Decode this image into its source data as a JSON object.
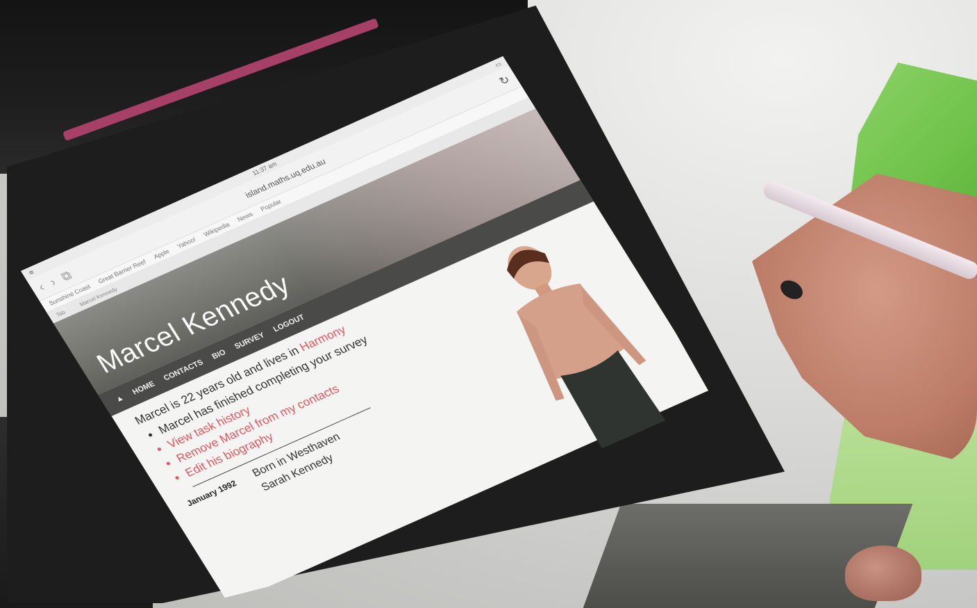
{
  "browser": {
    "status_time": "11:37 am",
    "url": "island.maths.uq.edu.au",
    "bookmarks": [
      "Sunshine Coast",
      "Great Barrier Reef",
      "Apple",
      "Yahoo!",
      "Wikipedia",
      "News",
      "Popular"
    ],
    "tabs": [
      "Tab",
      "Marcel Kennedy"
    ]
  },
  "site": {
    "title": "Marcel Kennedy",
    "nav": [
      "HOME",
      "CONTACTS",
      "BIO",
      "SURVEY",
      "LOGOUT"
    ]
  },
  "profile": {
    "intro_prefix": "Marcel is 22 years old and lives in ",
    "intro_place": "Harmony",
    "items": [
      "Marcel has finished completing your survey",
      "View task history",
      "Remove Marcel from my contacts",
      "Edit his biography"
    ],
    "timeline": [
      {
        "date": "January 1992",
        "event": "Born in Westhaven"
      },
      {
        "date": "",
        "event": "Sarah Kennedy"
      }
    ]
  },
  "colors": {
    "accent": "#e0555f",
    "nav_bg": "#4a4a48",
    "banner": "#777772",
    "bezel": "#1d1d1d",
    "case_edge": "#a74066"
  }
}
